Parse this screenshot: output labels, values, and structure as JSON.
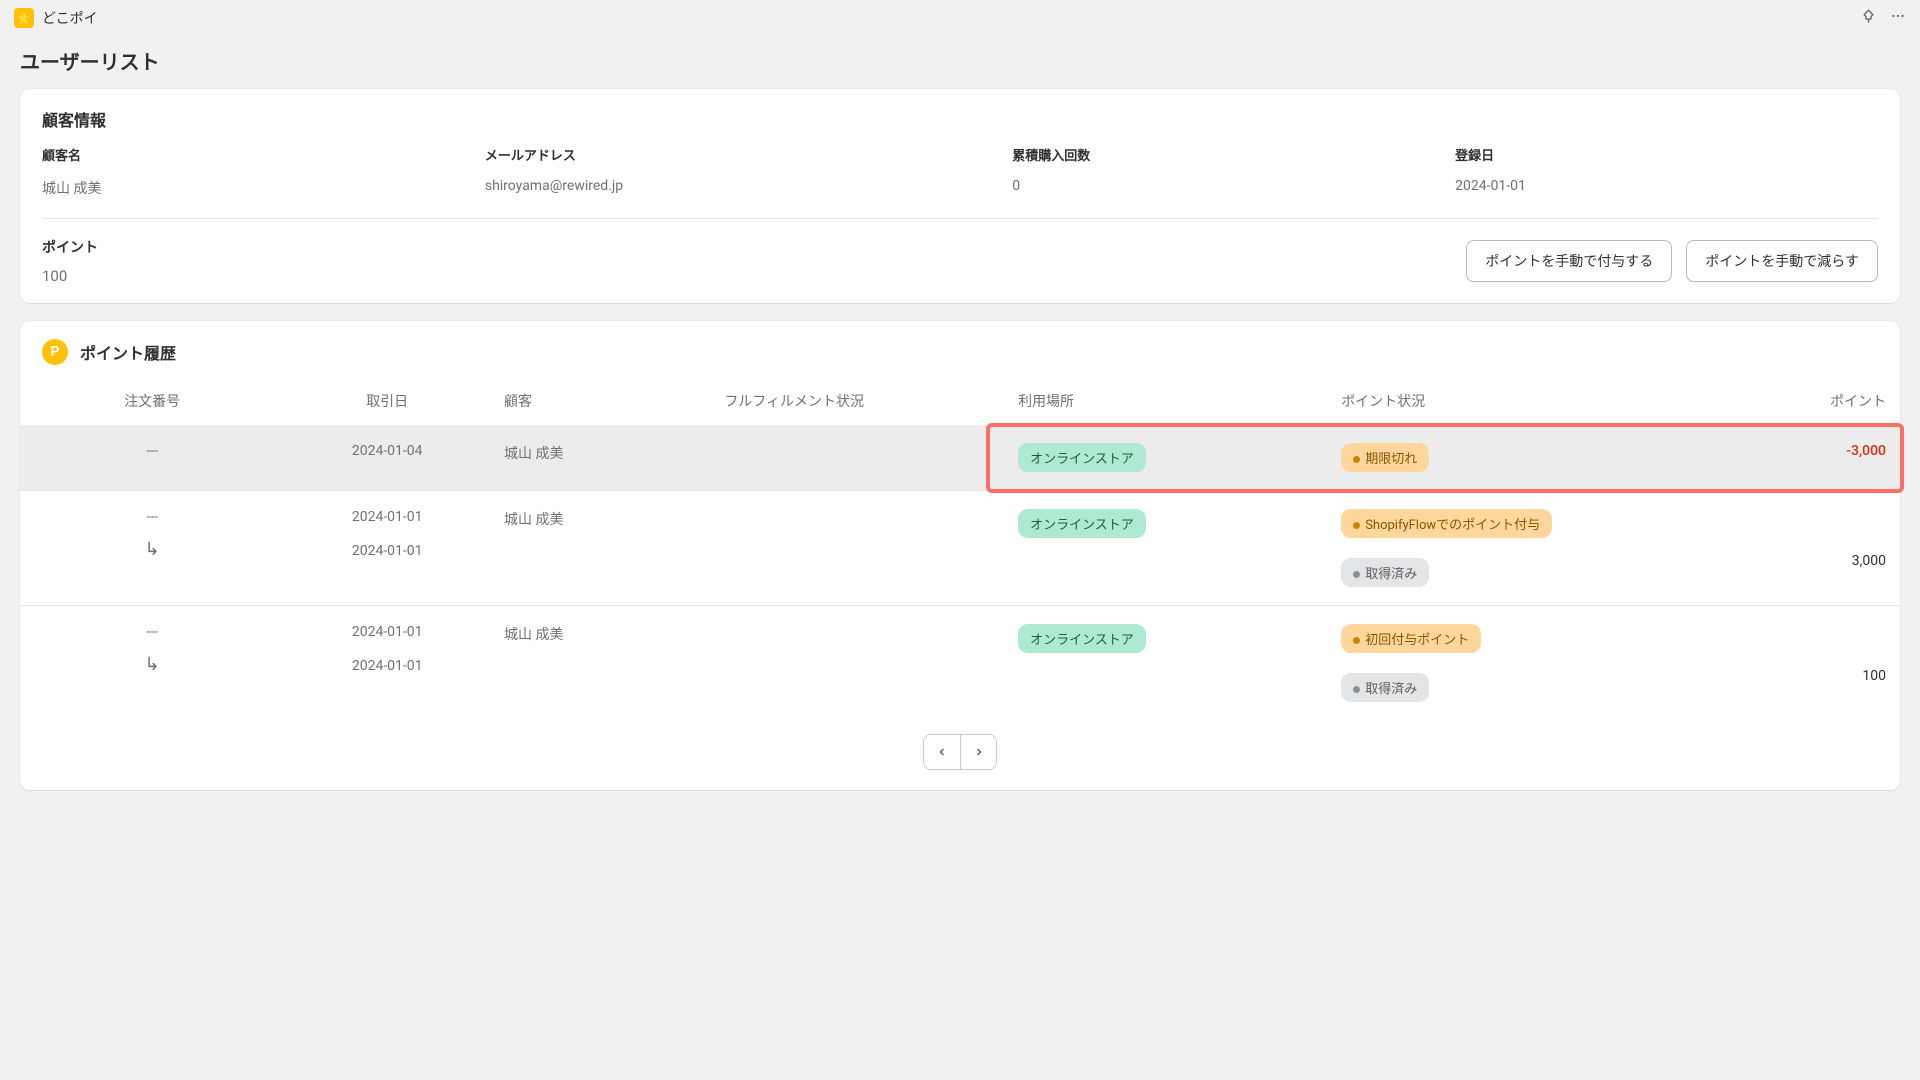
{
  "app": {
    "name": "どこポイ",
    "icon_glyph": "🌟"
  },
  "page_title": "ユーザーリスト",
  "customer_info": {
    "section_title": "顧客情報",
    "fields": {
      "name": {
        "label": "顧客名",
        "value": "城山 成美"
      },
      "email": {
        "label": "メールアドレス",
        "value": "shiroyama@rewired.jp"
      },
      "orders": {
        "label": "累積購入回数",
        "value": "0"
      },
      "registered": {
        "label": "登録日",
        "value": "2024-01-01"
      }
    }
  },
  "points": {
    "label": "ポイント",
    "value": "100",
    "buttons": {
      "add": "ポイントを手動で付与する",
      "sub": "ポイントを手動で減らす"
    }
  },
  "history": {
    "section_title": "ポイント履歴",
    "badge_letter": "P",
    "columns": {
      "order": "注文番号",
      "date": "取引日",
      "customer": "顧客",
      "fulfillment": "フルフィルメント状況",
      "location": "利用場所",
      "status": "ポイント状況",
      "points": "ポイント"
    },
    "rows": [
      {
        "order": "---",
        "date": "2024-01-04",
        "customer": "城山 成美",
        "fulfillment": "",
        "location": {
          "text": "オンラインストア",
          "color": "green"
        },
        "status_badges": [
          {
            "text": "期限切れ",
            "color": "amber",
            "dot": "amber"
          }
        ],
        "points": "-3,000",
        "points_negative": true,
        "highlighted": true,
        "has_sub": false
      },
      {
        "order": "---",
        "date": "2024-01-01",
        "sub_date": "2024-01-01",
        "customer": "城山 成美",
        "fulfillment": "",
        "location": {
          "text": "オンラインストア",
          "color": "green"
        },
        "status_badges": [
          {
            "text": "ShopifyFlowでのポイント付与",
            "color": "amber",
            "dot": "amber"
          },
          {
            "text": "取得済み",
            "color": "gray",
            "dot": "gray"
          }
        ],
        "points": "3,000",
        "points_negative": false,
        "highlighted": false,
        "has_sub": true
      },
      {
        "order": "---",
        "date": "2024-01-01",
        "sub_date": "2024-01-01",
        "customer": "城山 成美",
        "fulfillment": "",
        "location": {
          "text": "オンラインストア",
          "color": "green"
        },
        "status_badges": [
          {
            "text": "初回付与ポイント",
            "color": "amber",
            "dot": "amber"
          },
          {
            "text": "取得済み",
            "color": "gray",
            "dot": "gray"
          }
        ],
        "points": "100",
        "points_negative": false,
        "highlighted": false,
        "has_sub": true
      }
    ]
  }
}
